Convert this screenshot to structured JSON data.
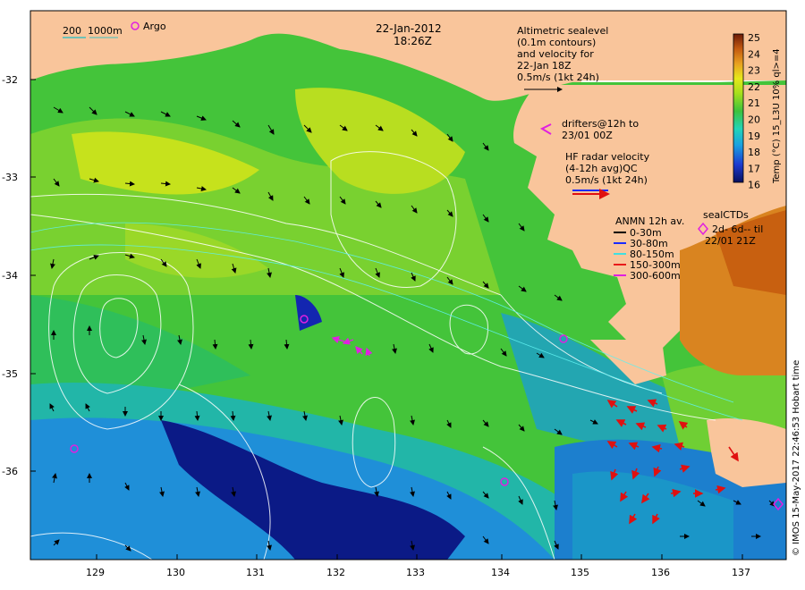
{
  "date_line": "22-Jan-2012",
  "time_line": "18:26Z",
  "isobath_legend": {
    "d1": "200",
    "d2": "1000m"
  },
  "argo_label": "Argo",
  "altimetry_lines": [
    "Altimetric sealevel",
    "(0.1m contours)",
    "and velocity for",
    "22-Jan 18Z",
    "0.5m/s (1kt 24h)"
  ],
  "drifters_lines": [
    "drifters@12h to",
    "23/01 00Z"
  ],
  "hf_lines": [
    "HF radar velocity",
    "(4-12h avg)QC",
    "0.5m/s (1kt 24h)"
  ],
  "anmn": {
    "title": "ANMN 12h av.",
    "items": [
      {
        "label": "0-30m",
        "color": "#000000"
      },
      {
        "label": "30-80m",
        "color": "#1a2bff"
      },
      {
        "label": "80-150m",
        "color": "#40e0e0"
      },
      {
        "label": "150-300m",
        "color": "#e81a1a"
      },
      {
        "label": "300-600m",
        "color": "#e020e0"
      }
    ]
  },
  "sealctd_lines": [
    "sealCTDs",
    "2d- 6d-- til",
    "22/01 21Z"
  ],
  "colorbar": {
    "title": "Temp (°C) 15_L3U 10% ql>=4",
    "ticks": [
      "25",
      "24",
      "23",
      "22",
      "21",
      "20",
      "19",
      "18",
      "17",
      "16"
    ],
    "min": 16,
    "max": 25
  },
  "y_axis": {
    "ticks": [
      "-32",
      "-33",
      "-34",
      "-35",
      "-36"
    ],
    "values": [
      -32,
      -33,
      -34,
      -35,
      -36
    ]
  },
  "x_axis": {
    "ticks": [
      "129",
      "130",
      "131",
      "132",
      "133",
      "134",
      "135",
      "136",
      "137"
    ],
    "values": [
      129,
      130,
      131,
      132,
      133,
      134,
      135,
      136,
      137
    ]
  },
  "credit": "© IMOS 15-May-2017 22:46:53 Hobart time",
  "colors": {
    "land": "#f9c59b",
    "ocean_mid": "#4ecb3c",
    "cold": "#0a1a8a",
    "warm": "#e8a020"
  }
}
